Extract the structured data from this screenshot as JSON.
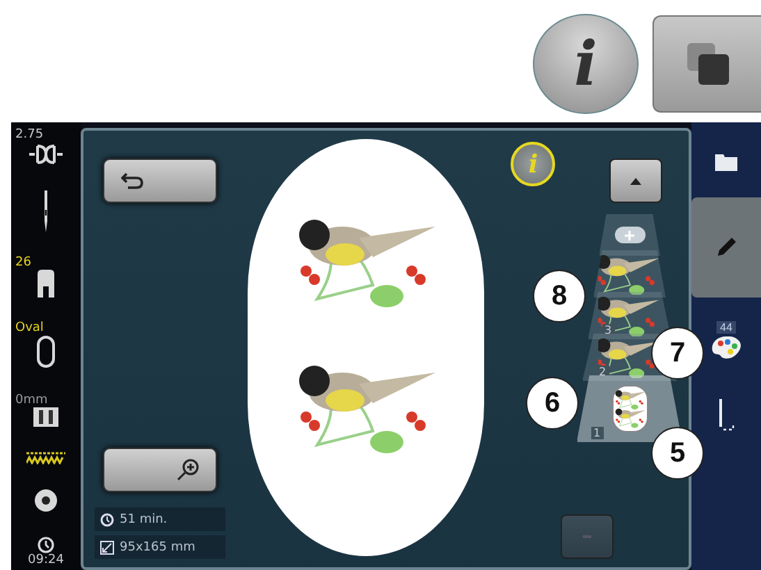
{
  "top_buttons": [
    {
      "kind": "info",
      "label": "i"
    },
    {
      "kind": "layers"
    }
  ],
  "status_sidebar": [
    {
      "kind": "tension",
      "value": "2.75",
      "color": "#c8c8c8"
    },
    {
      "kind": "needle"
    },
    {
      "kind": "foot",
      "value": "26",
      "color": "#e8d21e"
    },
    {
      "kind": "hoop",
      "value": "Oval",
      "color": "#e8d21e"
    },
    {
      "kind": "feed",
      "value": "0mm",
      "color": "#9a9a9a"
    },
    {
      "kind": "stitch"
    },
    {
      "kind": "bobbin"
    },
    {
      "kind": "clock",
      "value": "09:24",
      "color": "#c8c8c8"
    }
  ],
  "info_rows": [
    {
      "kind": "time",
      "text": "51 min."
    },
    {
      "kind": "size",
      "text": "95x165 mm"
    }
  ],
  "info_button": {
    "label": "i"
  },
  "layers": [
    {
      "kind": "add",
      "selected": false
    },
    {
      "kind": "design",
      "selected": false
    },
    {
      "kind": "design",
      "number": "3",
      "selected": false
    },
    {
      "kind": "design",
      "number": "2",
      "selected": false
    },
    {
      "kind": "combined",
      "number": "1",
      "selected": true
    }
  ],
  "callouts": [
    "8",
    "7",
    "6",
    "5"
  ],
  "nav": [
    {
      "kind": "folder",
      "selected": false
    },
    {
      "kind": "edit",
      "selected": true
    },
    {
      "kind": "colors",
      "badge": "44",
      "selected": false
    },
    {
      "kind": "stitch",
      "selected": false
    }
  ]
}
